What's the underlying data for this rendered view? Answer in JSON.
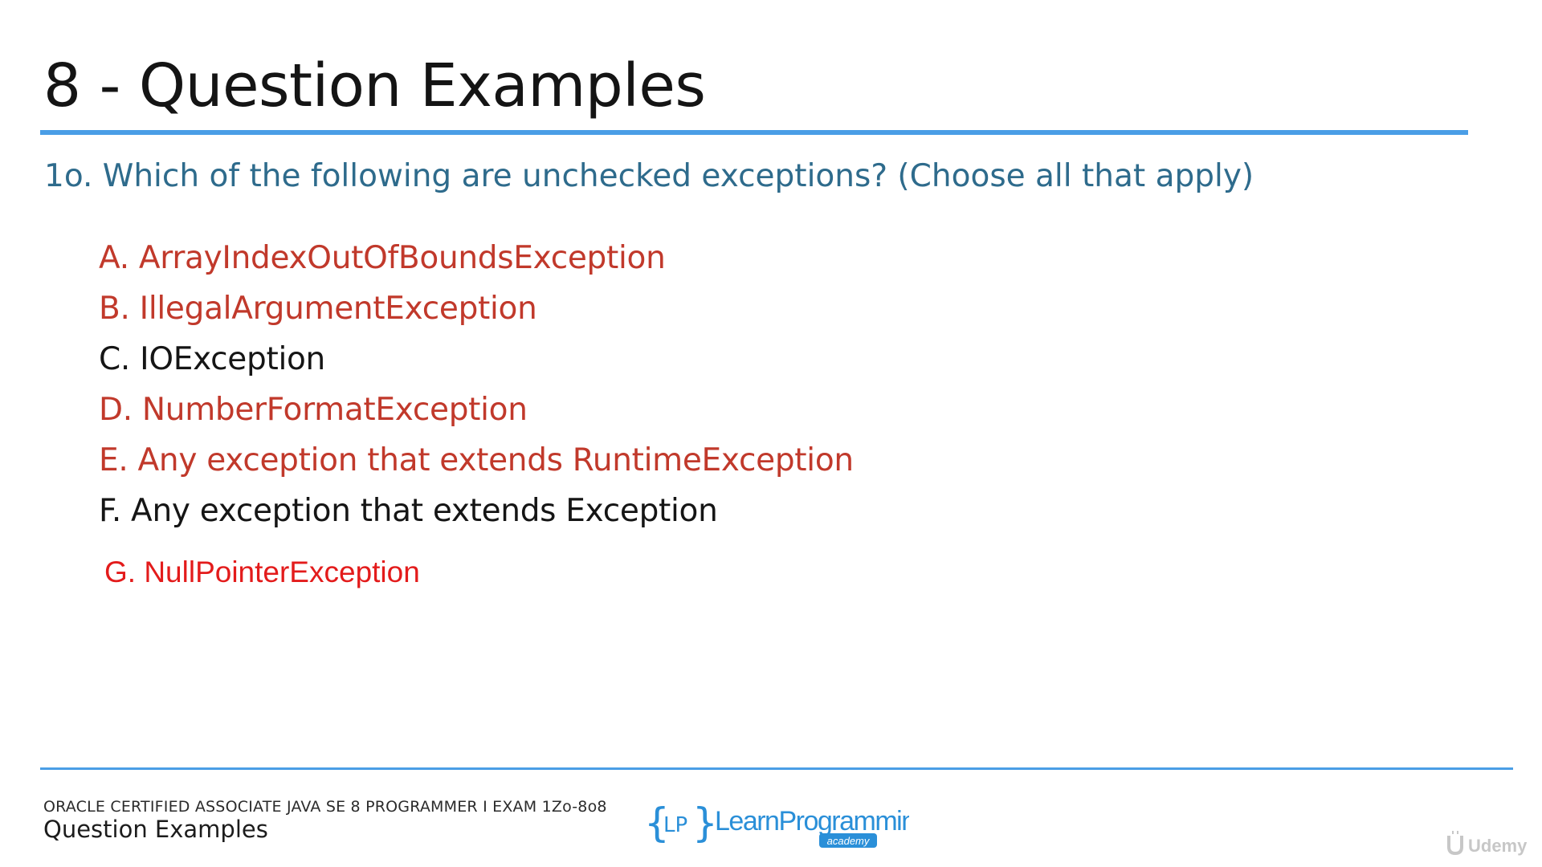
{
  "slide": {
    "title": "8 - Question Examples"
  },
  "question": {
    "text": "1o. Which of the following are unchecked exceptions? (Choose all that apply)"
  },
  "answers": [
    {
      "text": "A. ArrayIndexOutOfBoundsException",
      "status": "correct"
    },
    {
      "text": "B. IllegalArgumentException",
      "status": "correct"
    },
    {
      "text": "C. IOException",
      "status": "incorrect"
    },
    {
      "text": "D. NumberFormatException",
      "status": "correct"
    },
    {
      "text": "E. Any exception that extends RuntimeException",
      "status": "correct"
    },
    {
      "text": "F. Any exception that extends Exception",
      "status": "incorrect"
    },
    {
      "text": "G. NullPointerException",
      "status": "correct"
    }
  ],
  "footer": {
    "course": "ORACLE CERTIFIED ASSOCIATE JAVA SE 8 PROGRAMMER I EXAM 1Zo-8o8",
    "subtitle": "Question Examples"
  },
  "logo": {
    "brand": "LearnProgramming",
    "tagline": "academy",
    "icon": "lp-braces-logo-icon"
  },
  "watermark": {
    "text": "Udemy",
    "icon": "udemy-logo-icon"
  },
  "colors": {
    "accent_rule": "#4a9ee6",
    "question": "#2e6b8c",
    "correct_answer": "#c1392b",
    "correct_answer_added": "#e31b1b",
    "incorrect_answer": "#151515",
    "logo_blue": "#2a8fd8"
  }
}
